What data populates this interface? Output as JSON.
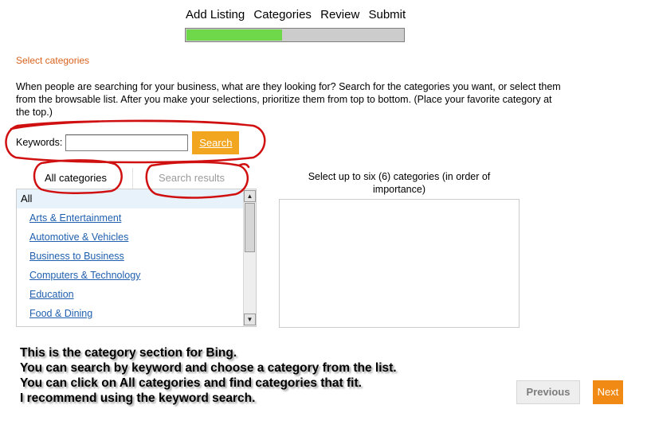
{
  "steps": [
    "Add Listing",
    "Categories",
    "Review",
    "Submit"
  ],
  "progress": {
    "value": 0.44,
    "fill_color": "#6fd84a"
  },
  "section_title": "Select categories",
  "intro": "When people are searching for your business, what are they looking for? Search for the categories you want, or select them from the browsable list. After you make your selections, prioritize them from top to bottom. (Place your favorite category at the top.)",
  "keyword": {
    "label": "Keywords:",
    "value": "",
    "button": "Search"
  },
  "tabs": {
    "all": "All categories",
    "search": "Search results"
  },
  "categories": {
    "header": "All",
    "items": [
      "Arts & Entertainment",
      "Automotive & Vehicles",
      "Business to Business",
      "Computers & Technology",
      "Education",
      "Food & Dining"
    ]
  },
  "selection_label": "Select up to six (6) categories (in order of importance)",
  "caption": [
    "This is the category section for Bing.",
    "You can search by keyword and choose a category from the list.",
    "You can click on All categories and find categories that fit.",
    "I recommend using the keyword search."
  ],
  "nav": {
    "previous": "Previous",
    "next": "Next"
  },
  "colors": {
    "accent_orange": "#f08a14",
    "search_button": "#f2a51f",
    "link": "#1f5fae",
    "annotation_red": "#d01010"
  }
}
